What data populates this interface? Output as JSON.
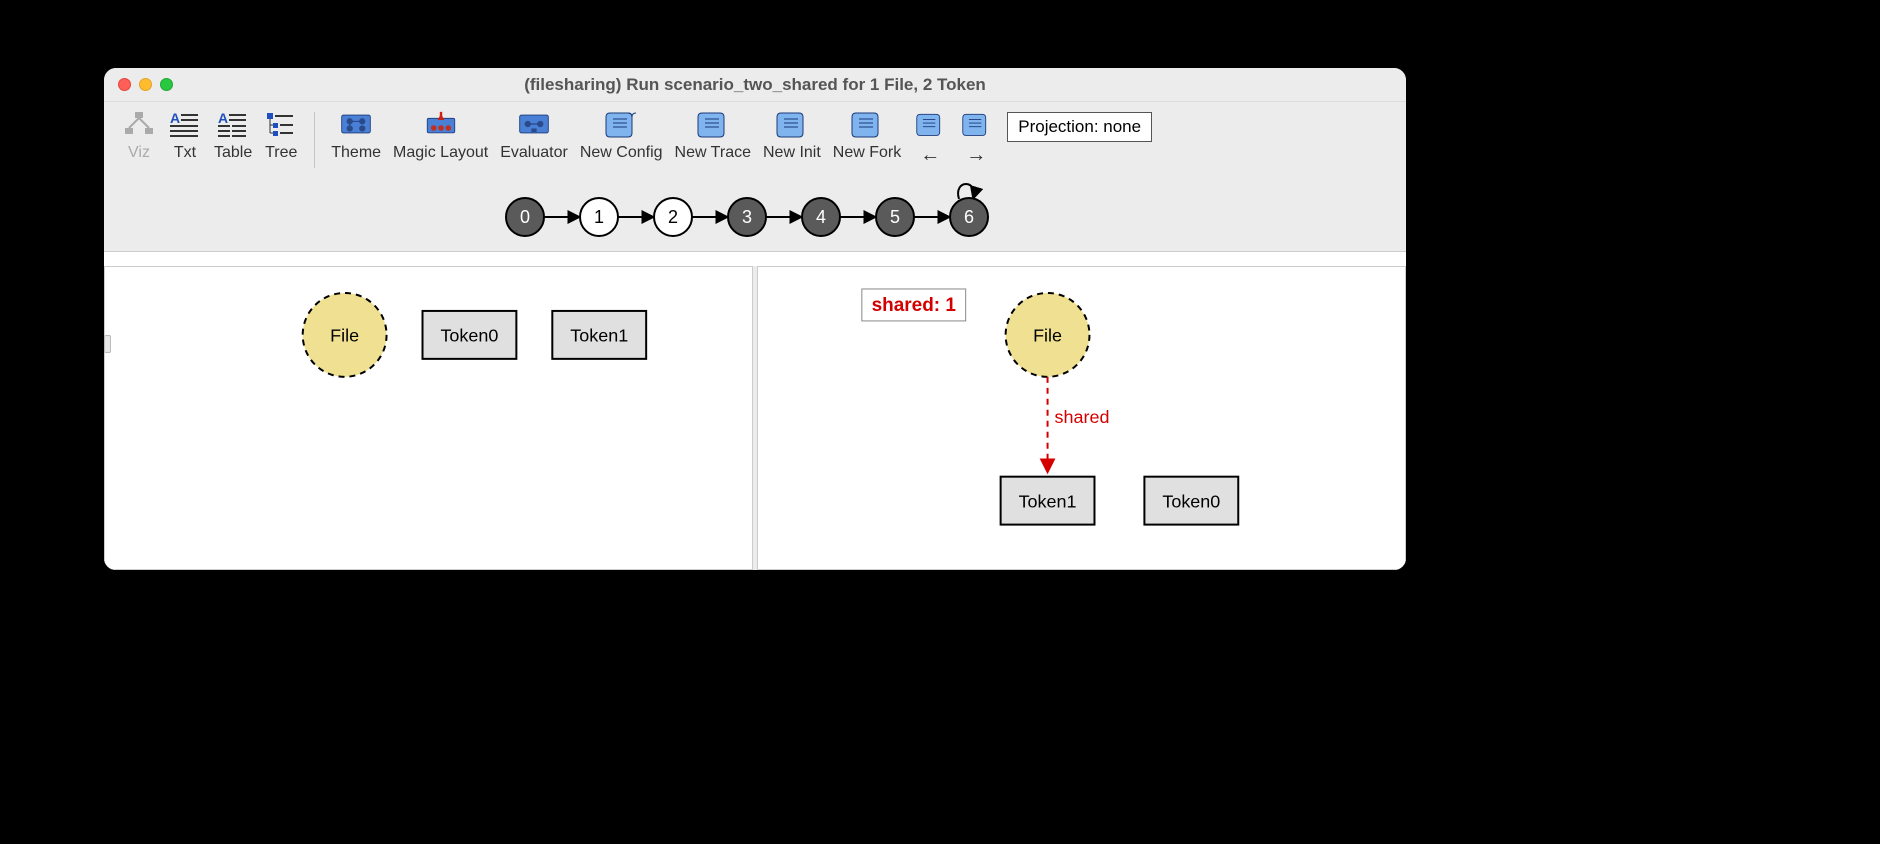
{
  "window": {
    "title": "(filesharing) Run scenario_two_shared for 1 File, 2 Token"
  },
  "toolbar": {
    "viz": "Viz",
    "txt": "Txt",
    "table": "Table",
    "tree": "Tree",
    "theme": "Theme",
    "magic_layout": "Magic Layout",
    "evaluator": "Evaluator",
    "new_config": "New Config",
    "new_trace": "New Trace",
    "new_init": "New Init",
    "new_fork": "New Fork",
    "prev": "←",
    "next": "→",
    "projection": "Projection: none"
  },
  "trace": {
    "states": [
      "0",
      "1",
      "2",
      "3",
      "4",
      "5",
      "6"
    ],
    "active": [
      1,
      2
    ],
    "loop_on": 6
  },
  "left_pane": {
    "file": "File",
    "token0": "Token0",
    "token1": "Token1"
  },
  "right_pane": {
    "shared_box": "shared: 1",
    "file": "File",
    "edge_label": "shared",
    "token1": "Token1",
    "token0": "Token0"
  }
}
